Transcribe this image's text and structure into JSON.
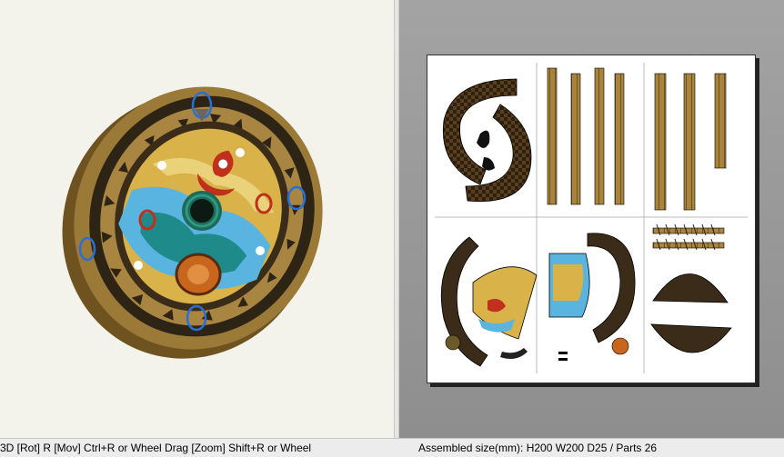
{
  "statusbar": {
    "controls_hint": "3D [Rot] R [Mov] Ctrl+R or Wheel Drag [Zoom] Shift+R or Wheel",
    "assembled_info": "Assembled size(mm): H200 W200 D25 / Parts 26"
  },
  "colors": {
    "view3d_bg": "#f3f3ec",
    "view2d_bg": "#999999",
    "wood": "#8a6a2a",
    "rim_dark": "#2e2416",
    "edge_select": "#2a6fd6",
    "paint_red": "#c0301c",
    "paint_teal": "#1e8a8a",
    "paint_sky": "#5ab4e0"
  },
  "icons": [
    "shield-model",
    "paper-pattern"
  ]
}
